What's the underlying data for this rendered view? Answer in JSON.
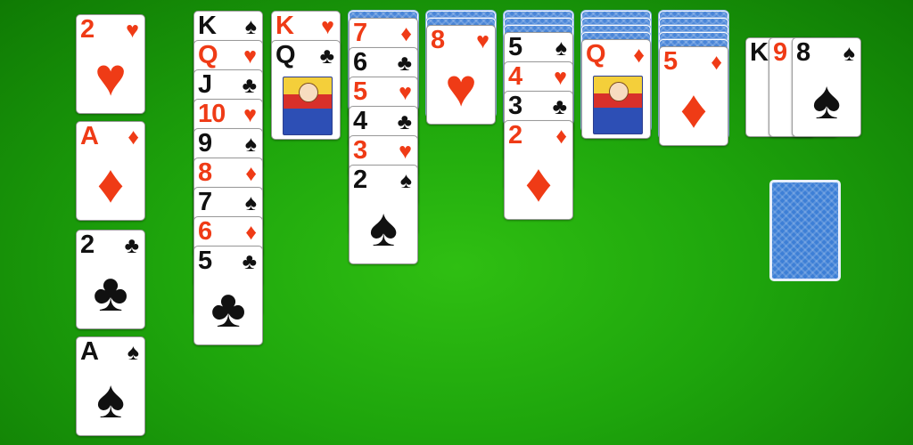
{
  "foundations": [
    {
      "rank": "2",
      "suit": "♥",
      "color": "red"
    },
    {
      "rank": "A",
      "suit": "♦",
      "color": "red"
    },
    {
      "rank": "2",
      "suit": "♣",
      "color": "black"
    },
    {
      "rank": "A",
      "suit": "♠",
      "color": "black"
    }
  ],
  "tableau": [
    {
      "facedown": 0,
      "cards": [
        {
          "rank": "K",
          "suit": "♠",
          "color": "black"
        },
        {
          "rank": "Q",
          "suit": "♥",
          "color": "red"
        },
        {
          "rank": "J",
          "suit": "♣",
          "color": "black"
        },
        {
          "rank": "10",
          "suit": "♥",
          "color": "red"
        },
        {
          "rank": "9",
          "suit": "♠",
          "color": "black"
        },
        {
          "rank": "8",
          "suit": "♦",
          "color": "red"
        },
        {
          "rank": "7",
          "suit": "♠",
          "color": "black"
        },
        {
          "rank": "6",
          "suit": "♦",
          "color": "red"
        },
        {
          "rank": "5",
          "suit": "♣",
          "color": "black"
        }
      ]
    },
    {
      "facedown": 0,
      "cards": [
        {
          "rank": "K",
          "suit": "♥",
          "color": "red"
        },
        {
          "rank": "Q",
          "suit": "♣",
          "color": "black",
          "face": true
        }
      ]
    },
    {
      "facedown": 1,
      "cards": [
        {
          "rank": "7",
          "suit": "♦",
          "color": "red"
        },
        {
          "rank": "6",
          "suit": "♣",
          "color": "black"
        },
        {
          "rank": "5",
          "suit": "♥",
          "color": "red"
        },
        {
          "rank": "4",
          "suit": "♣",
          "color": "black"
        },
        {
          "rank": "3",
          "suit": "♥",
          "color": "red"
        },
        {
          "rank": "2",
          "suit": "♠",
          "color": "black"
        }
      ]
    },
    {
      "facedown": 2,
      "cards": [
        {
          "rank": "8",
          "suit": "♥",
          "color": "red"
        }
      ]
    },
    {
      "facedown": 3,
      "cards": [
        {
          "rank": "5",
          "suit": "♠",
          "color": "black"
        },
        {
          "rank": "4",
          "suit": "♥",
          "color": "red"
        },
        {
          "rank": "3",
          "suit": "♣",
          "color": "black"
        },
        {
          "rank": "2",
          "suit": "♦",
          "color": "red"
        }
      ]
    },
    {
      "facedown": 4,
      "cards": [
        {
          "rank": "Q",
          "suit": "♦",
          "color": "red",
          "face": true
        }
      ]
    },
    {
      "facedown": 5,
      "cards": [
        {
          "rank": "5",
          "suit": "♦",
          "color": "red"
        }
      ]
    }
  ],
  "waste": [
    {
      "rank": "K",
      "suit": "♠",
      "color": "black"
    },
    {
      "rank": "9",
      "suit": "♥",
      "color": "red"
    },
    {
      "rank": "8",
      "suit": "♠",
      "color": "black"
    }
  ],
  "stock": {
    "count_shown": 1
  },
  "colors": {
    "red": "#ef3b16",
    "black": "#111111",
    "felt": "#1ea50c",
    "card_back": "#4a86d8"
  }
}
